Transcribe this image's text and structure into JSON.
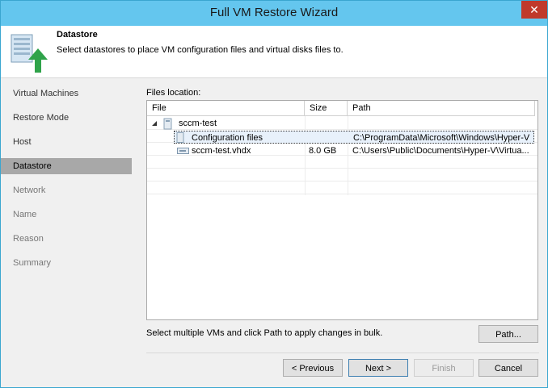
{
  "window": {
    "title": "Full VM Restore Wizard",
    "close_glyph": "✕"
  },
  "header": {
    "title": "Datastore",
    "description": "Select datastores to place VM configuration files and virtual disks files to.",
    "icon": "datastore-upload-icon"
  },
  "sidebar": {
    "items": [
      {
        "label": "Virtual Machines",
        "state": "normal"
      },
      {
        "label": "Restore Mode",
        "state": "normal"
      },
      {
        "label": "Host",
        "state": "normal"
      },
      {
        "label": "Datastore",
        "state": "active"
      },
      {
        "label": "Network",
        "state": "disabled"
      },
      {
        "label": "Name",
        "state": "disabled"
      },
      {
        "label": "Reason",
        "state": "disabled"
      },
      {
        "label": "Summary",
        "state": "disabled"
      }
    ]
  },
  "files": {
    "label": "Files location:",
    "columns": {
      "file": "File",
      "size": "Size",
      "path": "Path"
    },
    "tree": {
      "vm": {
        "name": "sccm-test",
        "expand_glyph": "◢"
      },
      "config": {
        "name": "Configuration files",
        "size": "",
        "path": "C:\\ProgramData\\Microsoft\\Windows\\Hyper-V"
      },
      "disk": {
        "name": "sccm-test.vhdx",
        "size": "8.0 GB",
        "path": "C:\\Users\\Public\\Documents\\Hyper-V\\Virtua..."
      }
    }
  },
  "hint": "Select multiple VMs and click Path to apply changes in bulk.",
  "buttons": {
    "path": "Path...",
    "previous": "< Previous",
    "next": "Next >",
    "finish": "Finish",
    "cancel": "Cancel"
  }
}
